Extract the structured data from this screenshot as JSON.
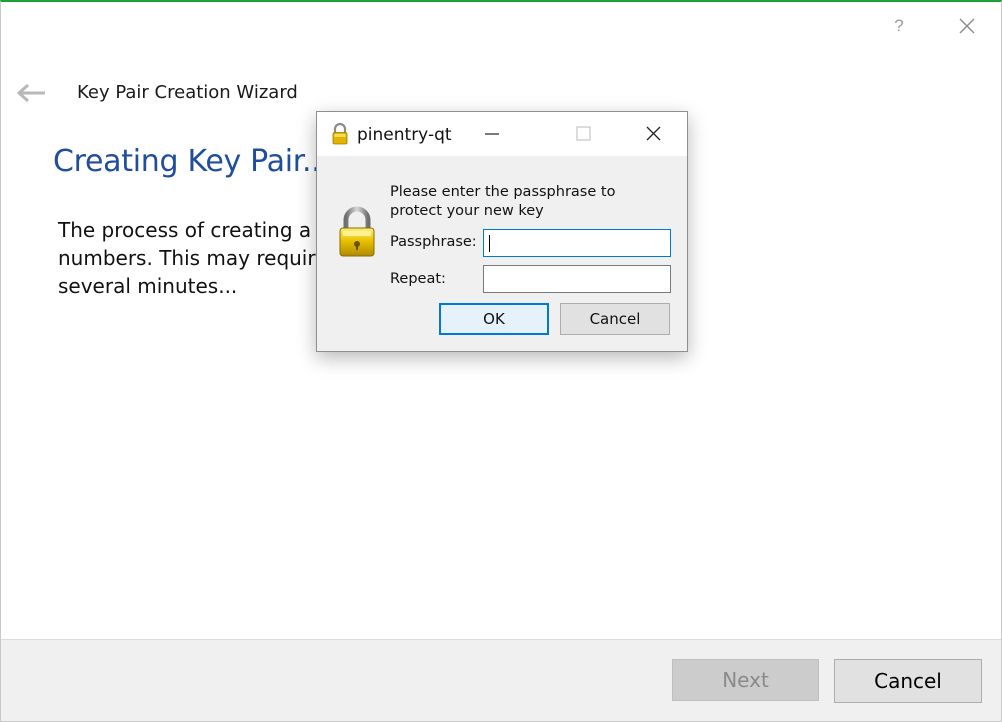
{
  "wizard": {
    "help_glyph": "?",
    "title": "Key Pair Creation Wizard",
    "heading": "Creating Key Pair...",
    "body_line1_left": "The process of creating a k",
    "body_line1_right": "numbers. This may require",
    "body_line2": "several minutes...",
    "accent_color": "#1ba13c",
    "heading_color": "#1f4e9c",
    "icons": {
      "back": "back-arrow-icon",
      "close": "close-icon",
      "help": "help-icon"
    }
  },
  "footer": {
    "next_label": "Next",
    "cancel_label": "Cancel"
  },
  "dialog": {
    "title": "pinentry-qt",
    "prompt": "Please enter the passphrase to protect your new key",
    "passphrase_label": "Passphrase:",
    "passphrase_value": "",
    "repeat_label": "Repeat:",
    "repeat_value": "",
    "ok_label": "OK",
    "cancel_label": "Cancel",
    "focus_color": "#0078d7",
    "icons": {
      "title": "padlock-icon",
      "main": "padlock-icon",
      "minimize": "minimize-icon",
      "maximize": "maximize-icon",
      "close": "close-icon"
    }
  }
}
